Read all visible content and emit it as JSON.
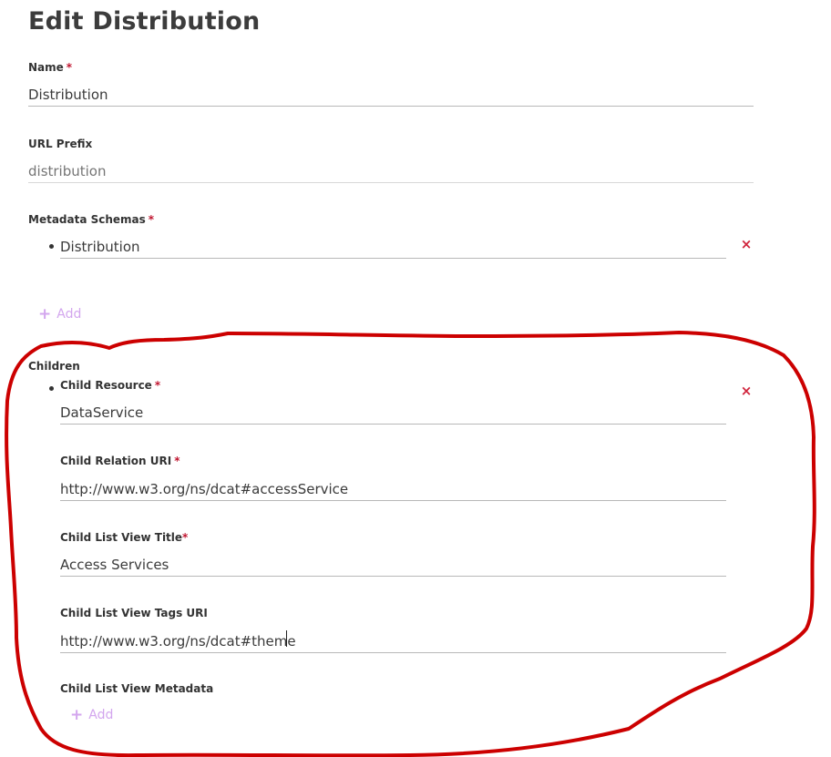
{
  "page": {
    "title": "Edit Distribution"
  },
  "fields": {
    "name": {
      "label": "Name",
      "required_mark": "*",
      "value": "Distribution"
    },
    "url_prefix": {
      "label": "URL Prefix",
      "value": "",
      "placeholder": "distribution"
    },
    "metadata_schemas": {
      "label": "Metadata Schemas",
      "required_mark": "*",
      "items": [
        {
          "value": "Distribution",
          "remove_label": "×"
        }
      ],
      "add_label": "Add"
    }
  },
  "children": {
    "label": "Children",
    "items": [
      {
        "remove_label": "×",
        "child_resource": {
          "label": "Child Resource",
          "required_mark": "*",
          "value": "DataService"
        },
        "child_relation_uri": {
          "label": "Child Relation URI",
          "required_mark": "*",
          "value": "http://www.w3.org/ns/dcat#accessService"
        },
        "child_list_view_title": {
          "label": "Child List View Title",
          "required_mark": "*",
          "value": "Access Services"
        },
        "child_list_view_tags_uri": {
          "label": "Child List View Tags URI",
          "value": "http://www.w3.org/ns/dcat#theme"
        },
        "child_list_view_metadata": {
          "label": "Child List View Metadata",
          "add_label": "Add"
        }
      }
    ]
  },
  "colors": {
    "required": "#c0152f",
    "remove": "#d0243c",
    "add": "#d3a6ee",
    "annotation": "#cc0000"
  },
  "icons": {
    "remove": "close-icon",
    "add": "plus-icon"
  }
}
